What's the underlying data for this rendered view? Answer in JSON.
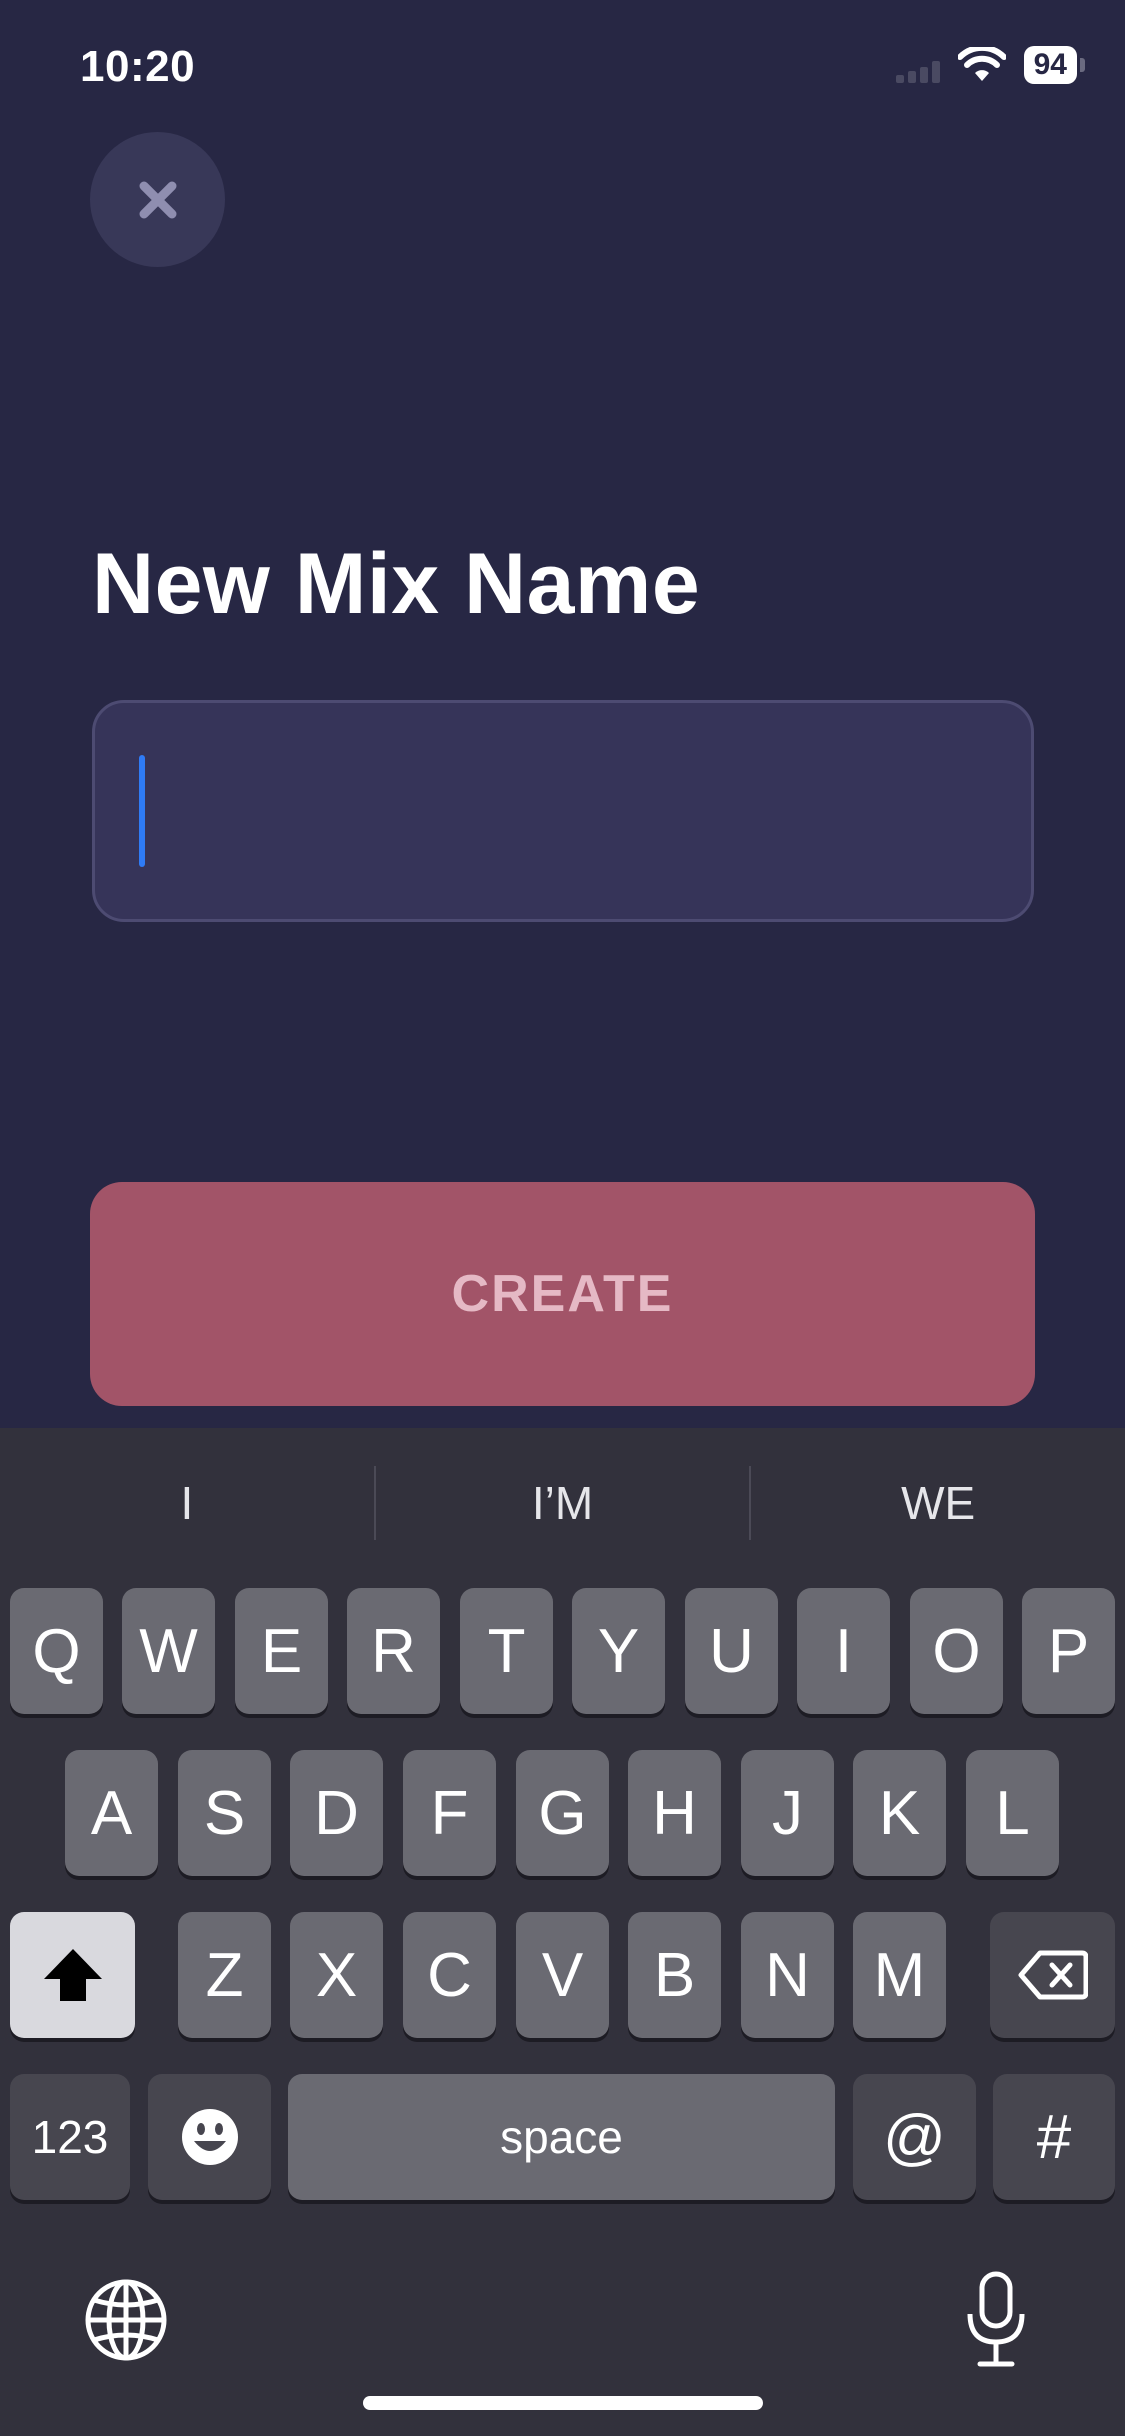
{
  "status_bar": {
    "time": "10:20",
    "battery": "94"
  },
  "screen": {
    "title": "New Mix Name",
    "input": {
      "value": "",
      "placeholder": ""
    },
    "create_label": "CREATE"
  },
  "keyboard": {
    "suggestions": [
      "I",
      "I’M",
      "WE"
    ],
    "row1": [
      "Q",
      "W",
      "E",
      "R",
      "T",
      "Y",
      "U",
      "I",
      "O",
      "P"
    ],
    "row2": [
      "A",
      "S",
      "D",
      "F",
      "G",
      "H",
      "J",
      "K",
      "L"
    ],
    "row3": [
      "Z",
      "X",
      "C",
      "V",
      "B",
      "N",
      "M"
    ],
    "numbers_label": "123",
    "space_label": "space",
    "at_label": "@",
    "hash_label": "#"
  },
  "icons": {
    "close": "close-icon",
    "shift": "shift-icon",
    "backspace": "backspace-icon",
    "emoji": "emoji-icon",
    "globe": "globe-icon",
    "mic": "microphone-icon",
    "wifi": "wifi-icon",
    "signal": "cellular-signal-icon"
  },
  "colors": {
    "background": "#272744",
    "accent_create": "#a25468",
    "caret": "#2f7bf6"
  }
}
